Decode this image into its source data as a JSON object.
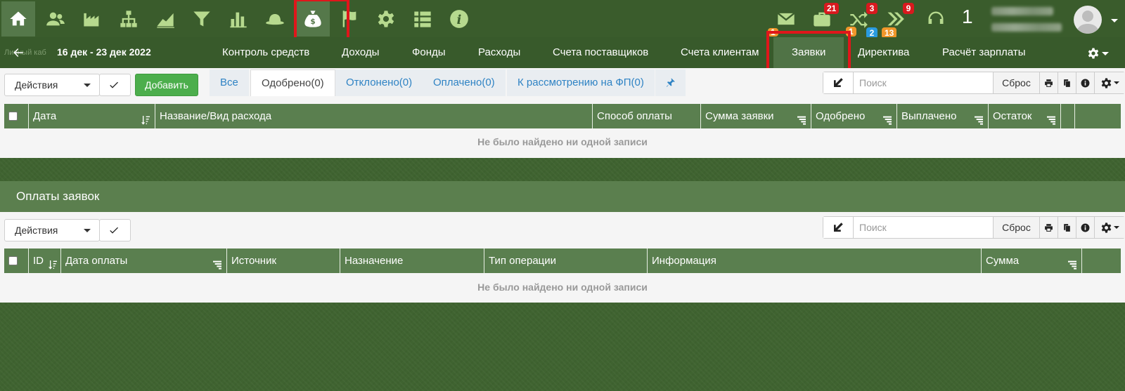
{
  "topbar": {
    "icons": [
      "home-icon",
      "users-icon",
      "factory-icon",
      "org-chart-icon",
      "area-chart-icon",
      "funnel-icon",
      "bar-chart-icon",
      "hat-icon",
      "money-bag-icon",
      "flag-icon",
      "gear-icon",
      "list-icon",
      "info-icon"
    ],
    "badges": {
      "cart_top": "21",
      "cart_bottom": "1",
      "mail_bottom": "1",
      "shuffle_top": "3",
      "shuffle_blue": "2",
      "shuffle_orange": "13",
      "chevrons_top": "9"
    },
    "counter": "1"
  },
  "subnav": {
    "ghost": "Личный каб",
    "date_range": "16 дек - 23 дек 2022",
    "items": [
      "Контроль средств",
      "Доходы",
      "Фонды",
      "Расходы",
      "Счета поставщиков",
      "Счета клиентам",
      "Заявки",
      "Директива",
      "Расчёт зарплаты"
    ]
  },
  "requests": {
    "actions_label": "Действия",
    "add_label": "Добавить",
    "tabs": [
      "Все",
      "Одобрено(0)",
      "Отклонено(0)",
      "Оплачено(0)",
      "К рассмотрению на ФП(0)"
    ],
    "search_placeholder": "Поиск",
    "reset_label": "Сброс",
    "columns": [
      "Дата",
      "Название/Вид расхода",
      "Способ оплаты",
      "Сумма заявки",
      "Одобрено",
      "Выплачено",
      "Остаток"
    ],
    "empty": "Не было найдено ни одной записи"
  },
  "payments": {
    "title": "Оплаты заявок",
    "actions_label": "Действия",
    "search_placeholder": "Поиск",
    "reset_label": "Сброс",
    "columns": [
      "ID",
      "Дата оплаты",
      "Источник",
      "Назначение",
      "Тип операции",
      "Информация",
      "Сумма"
    ],
    "empty": "Не было найдено ни одной записи"
  },
  "colors": {
    "bg": "#3f6330",
    "topbar": "#3a5c2c",
    "header_green": "#5a7f4f",
    "highlight_red": "#e0161b",
    "add_green": "#4cae4c"
  }
}
